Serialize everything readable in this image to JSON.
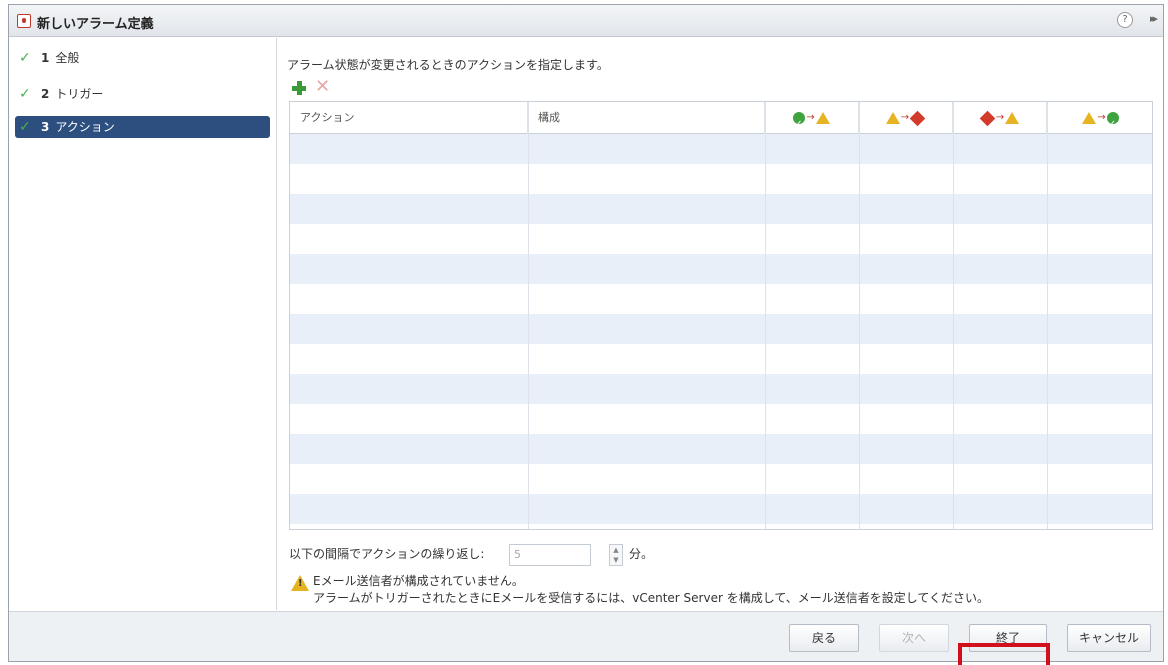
{
  "window": {
    "title": "新しいアラーム定義",
    "help_label": "?",
    "expand_label": "▸▸"
  },
  "steps": [
    {
      "num": "1",
      "label": "全般",
      "state": "done"
    },
    {
      "num": "2",
      "label": "トリガー",
      "state": "done"
    },
    {
      "num": "3",
      "label": "アクション",
      "state": "active"
    }
  ],
  "main": {
    "description": "アラーム状態が変更されるときのアクションを指定します。",
    "toolbar": {
      "add_icon": "add-icon",
      "remove_icon": "remove-icon"
    },
    "grid": {
      "columns": [
        "アクション",
        "構成",
        "ok-to-warning",
        "warning-to-alert",
        "alert-to-warning",
        "warning-to-ok"
      ],
      "row_count": 13,
      "rows": []
    },
    "repeat": {
      "label": "以下の間隔でアクションの繰り返し:",
      "value": "5",
      "unit": "分。"
    },
    "warning": {
      "line1": "Eメール送信者が構成されていません。",
      "line2": "アラームがトリガーされたときにEメールを受信するには、vCenter Server を構成して、メール送信者を設定してください。"
    }
  },
  "footer": {
    "back": "戻る",
    "next": "次へ",
    "finish": "終了",
    "cancel": "キャンセル"
  },
  "colors": {
    "active_step": "#2d4f7f",
    "row_alt": "#e8eff8",
    "highlight": "#d0101a",
    "ok": "#3fa33f",
    "warning": "#e6b422",
    "alert": "#d23a2c"
  }
}
